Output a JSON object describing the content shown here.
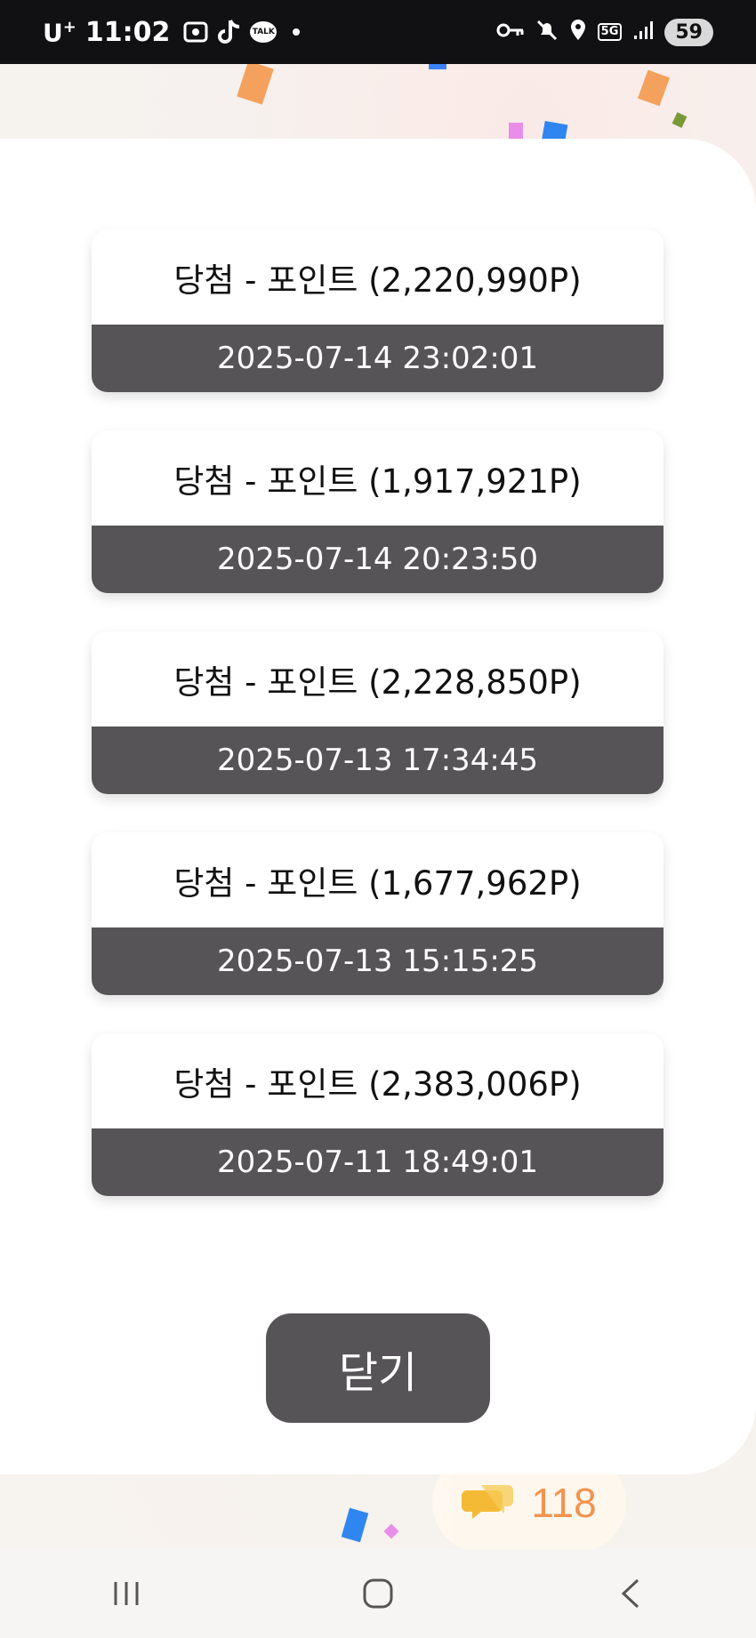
{
  "status_bar": {
    "carrier": "U",
    "carrier_sup": "+",
    "time": "11:02",
    "battery": "59",
    "talk_label": "TALK",
    "network": "5G",
    "left_icons": [
      "screenshot-icon",
      "tiktok-icon",
      "kakaotalk-icon",
      "notification-dot-icon"
    ],
    "right_icons": [
      "key-icon",
      "mute-icon",
      "location-icon",
      "5g-icon",
      "signal-icon",
      "battery-icon"
    ]
  },
  "history": {
    "items": [
      {
        "title": "당첨 - 포인트 (2,220,990P)",
        "date": "2025-07-14 23:02:01"
      },
      {
        "title": "당첨 - 포인트 (1,917,921P)",
        "date": "2025-07-14 20:23:50"
      },
      {
        "title": "당첨 - 포인트 (2,228,850P)",
        "date": "2025-07-13 17:34:45"
      },
      {
        "title": "당첨 - 포인트 (1,677,962P)",
        "date": "2025-07-13 15:15:25"
      },
      {
        "title": "당첨 - 포인트 (2,383,006P)",
        "date": "2025-07-11 18:49:01"
      }
    ],
    "close_label": "닫기"
  },
  "background": {
    "counter_value": "118",
    "counter_icon": "chat-icon"
  },
  "nav_bar": {
    "buttons": [
      "recent-apps-icon",
      "home-icon",
      "back-icon"
    ]
  },
  "colors": {
    "status_bar_bg": "#111114",
    "date_strip_bg": "#565456",
    "close_button_bg": "#565456",
    "counter_accent": "#f08a3e"
  }
}
